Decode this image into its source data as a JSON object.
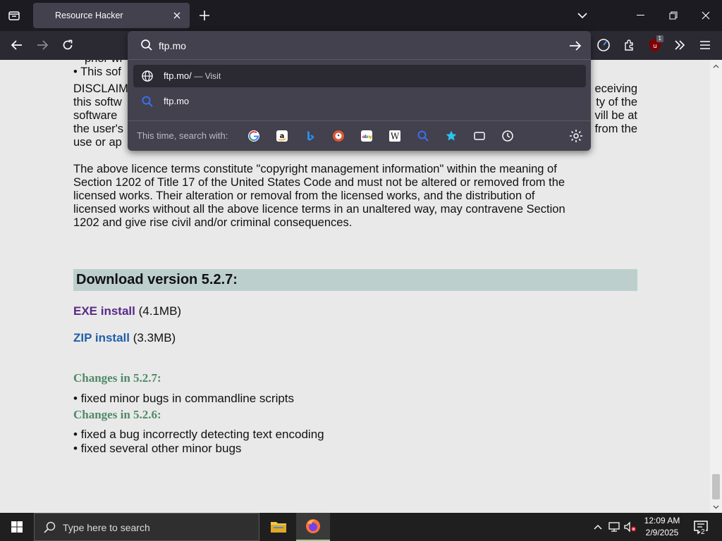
{
  "browser": {
    "tab_title": "Resource Hacker",
    "ublock_badge": "1"
  },
  "urlbar": {
    "value": "ftp.mo",
    "suggestions": [
      {
        "text": "ftp.mo/",
        "sub": "— Visit",
        "icon": "globe-icon"
      },
      {
        "text": "ftp.mo",
        "sub": "",
        "icon": "search-icon"
      }
    ],
    "oneoff_label": "This time, search with:",
    "engines": [
      "google-icon",
      "amazon-icon",
      "bing-icon",
      "duckduckgo-icon",
      "ebay-icon",
      "wikipedia-icon",
      "search-icon",
      "bookmarks-icon",
      "tabs-icon",
      "history-icon"
    ]
  },
  "page": {
    "top_partial": "prior wr",
    "bullet_partial": "• This sof",
    "disclaimer_lines": [
      {
        "left": "DISCLAIM",
        "right": "eceiving"
      },
      {
        "left": "this softw",
        "right": "ty of the"
      },
      {
        "left": "software",
        "right": "vill be at"
      },
      {
        "left": "the user's",
        "right": "from the"
      },
      {
        "left": "use or ap",
        "right": ""
      }
    ],
    "licence_lines": [
      "The above licence terms constitute \"copyright management information\" within the meaning of",
      "Section 1202 of Title 17 of the United States Code and must not be altered or removed from the",
      "licensed works. Their alteration or removal from the licensed works, and the distribution of",
      "licensed works without all the above licence terms in an unaltered way, may contravene Section",
      "1202 and give rise civil and/or criminal consequences."
    ],
    "download_heading": "Download version 5.2.7:",
    "exe_link": "EXE install",
    "exe_size": "(4.1MB)",
    "zip_link": "ZIP install",
    "zip_size": "(3.3MB)",
    "changes_527": "Changes in 5.2.7:",
    "changes_527_items": [
      "• fixed minor bugs in commandline scripts"
    ],
    "changes_526": "Changes in 5.2.6:",
    "changes_526_items": [
      "• fixed a bug incorrectly detecting text encoding",
      "• fixed several other minor bugs"
    ]
  },
  "taskbar": {
    "search_placeholder": "Type here to search",
    "time": "12:09 AM",
    "date": "2/9/2025",
    "notification_count": "2"
  }
}
